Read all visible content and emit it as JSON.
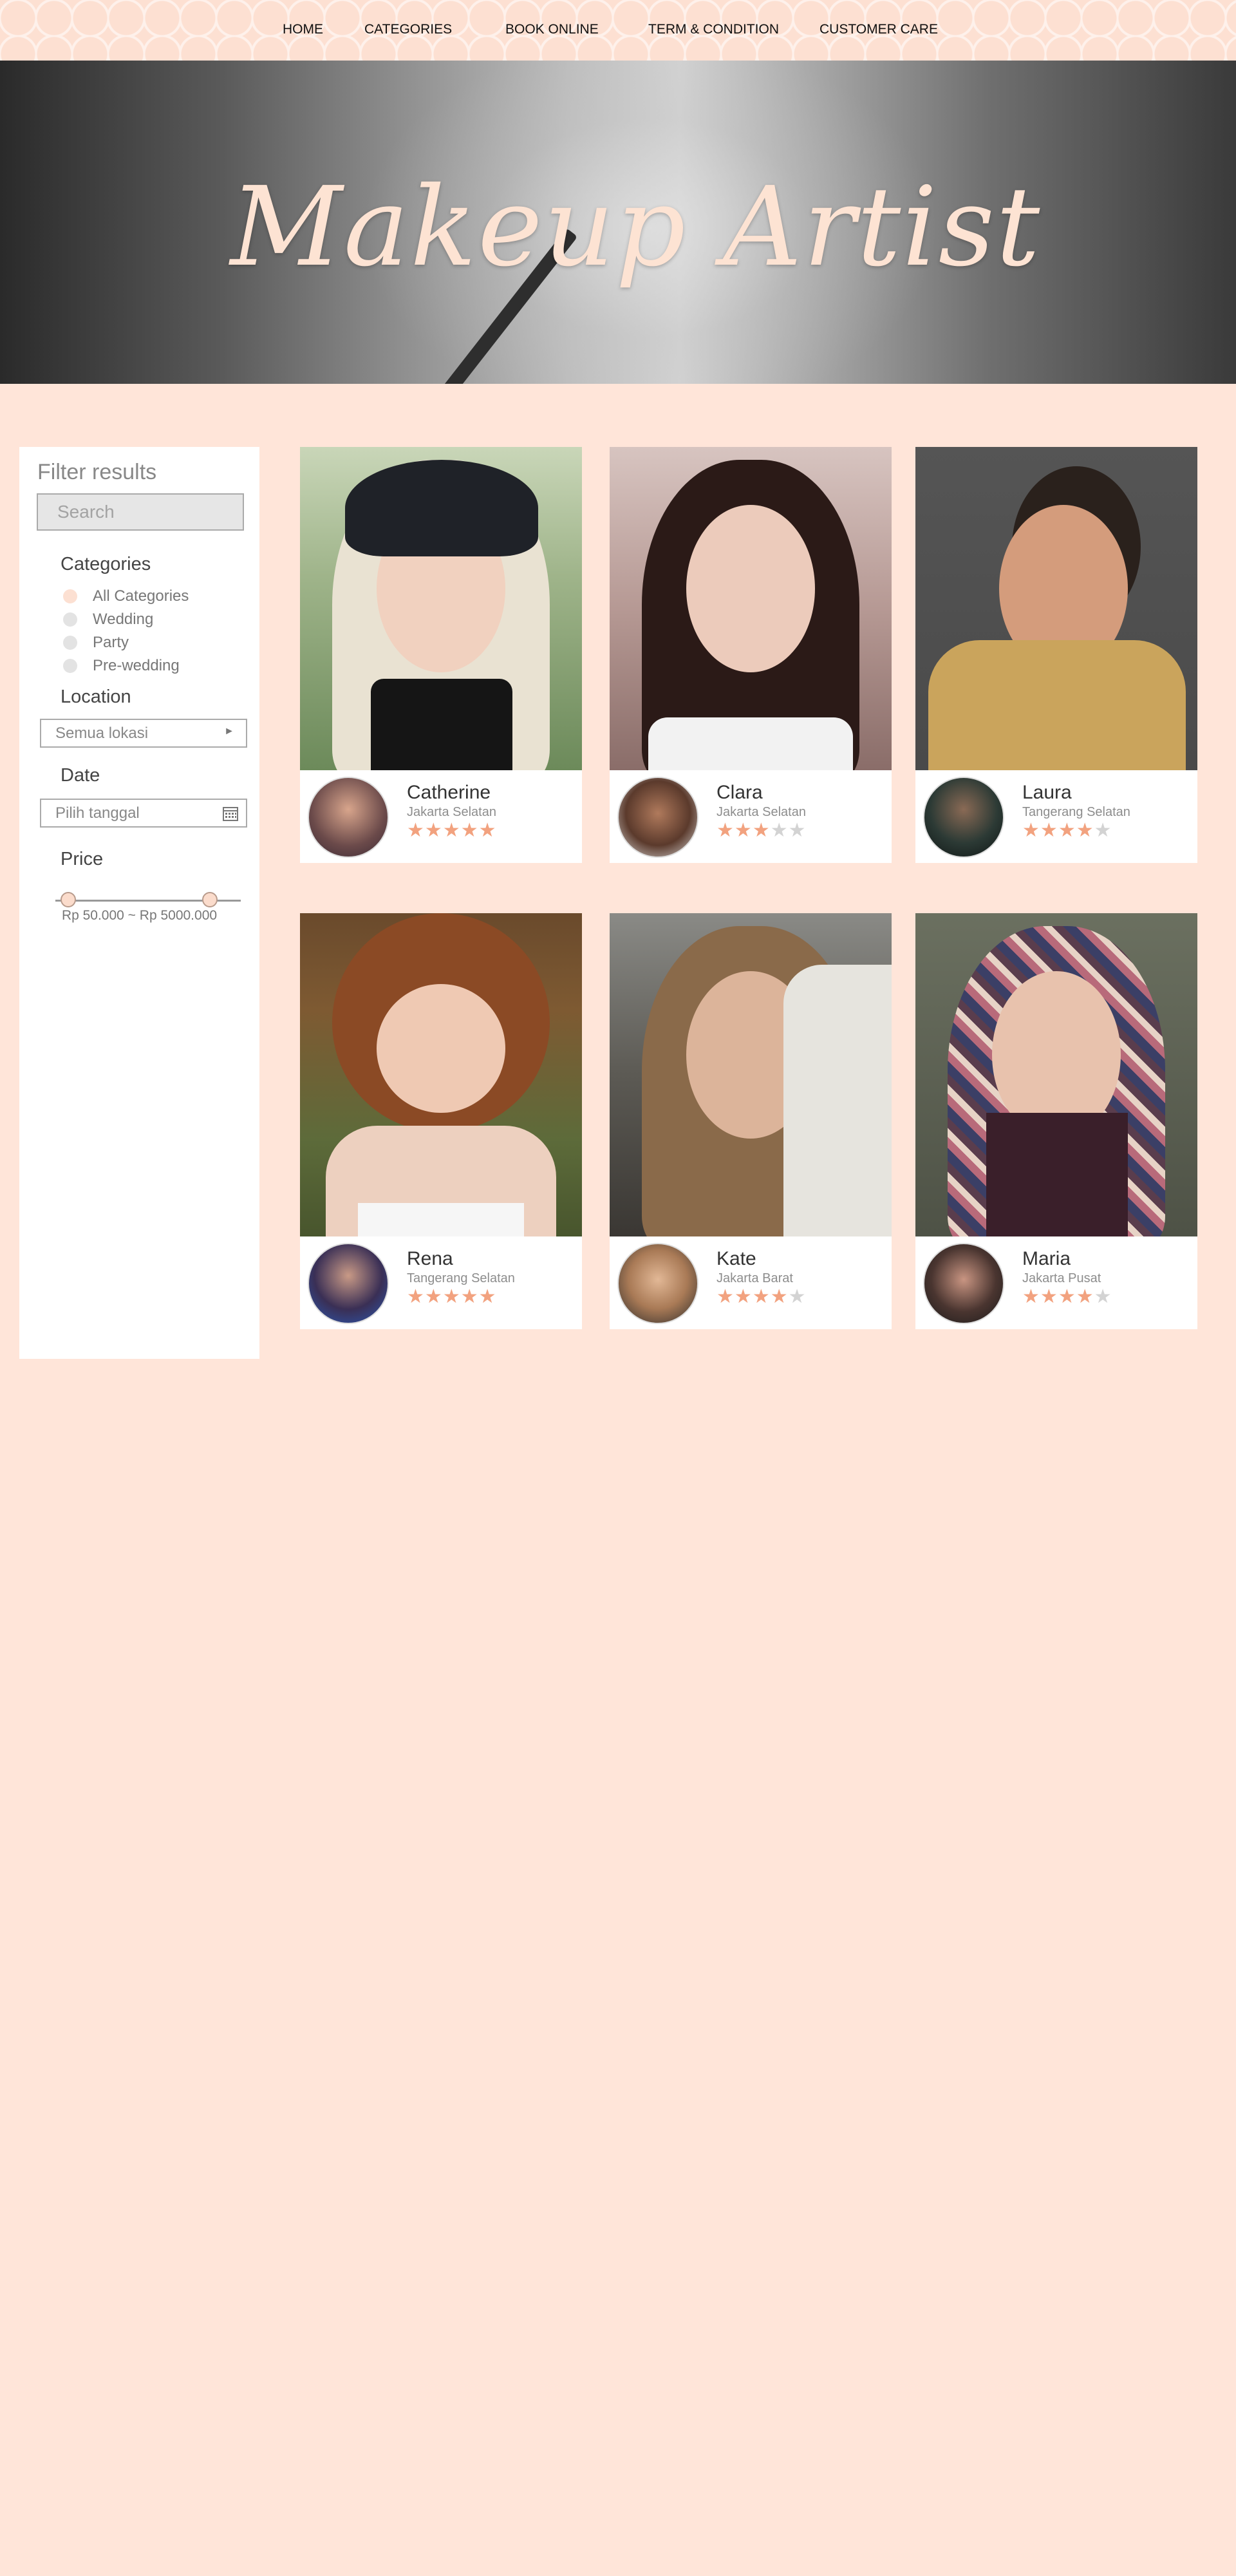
{
  "nav": {
    "items": [
      {
        "label": "HOME"
      },
      {
        "label": "CATEGORIES"
      },
      {
        "label": "BOOK ONLINE"
      },
      {
        "label": "TERM & CONDITION"
      },
      {
        "label": "CUSTOMER CARE"
      }
    ]
  },
  "hero": {
    "title": "Makeup Artist"
  },
  "filter": {
    "title": "Filter results",
    "search_placeholder": "Search",
    "categories_heading": "Categories",
    "categories": [
      {
        "label": "All Categories",
        "selected": true
      },
      {
        "label": "Wedding",
        "selected": false
      },
      {
        "label": "Party",
        "selected": false
      },
      {
        "label": "Pre-wedding",
        "selected": false
      }
    ],
    "location_heading": "Location",
    "location_value": "Semua lokasi",
    "date_heading": "Date",
    "date_placeholder": "Pilih tanggal",
    "price_heading": "Price",
    "price_range": "Rp 50.000 ~ Rp 5000.000"
  },
  "artists": [
    {
      "name": "Catherine",
      "location": "Jakarta Selatan",
      "rating": 5
    },
    {
      "name": "Clara",
      "location": "Jakarta Selatan",
      "rating": 3
    },
    {
      "name": "Laura",
      "location": "Tangerang Selatan",
      "rating": 4
    },
    {
      "name": "Rena",
      "location": "Tangerang Selatan",
      "rating": 5
    },
    {
      "name": "Kate",
      "location": "Jakarta Barat",
      "rating": 4
    },
    {
      "name": "Maria",
      "location": "Jakarta Pusat",
      "rating": 4
    }
  ],
  "colors": {
    "background": "#ffe5d9",
    "accent": "#fde3d3",
    "star_on": "#f2a27f",
    "star_off": "#d3d3d3"
  }
}
